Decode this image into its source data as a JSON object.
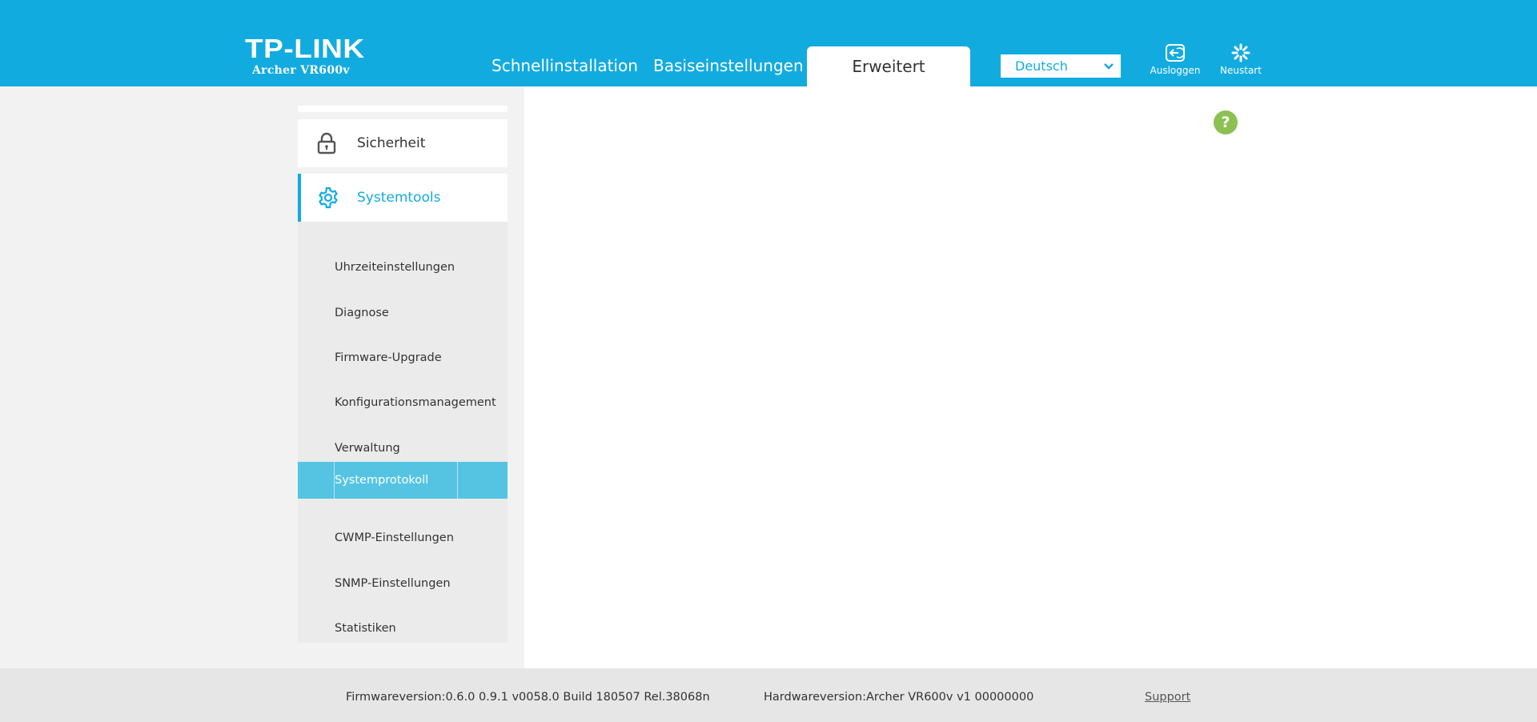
{
  "header": {
    "logo": "TP-LINK",
    "model": "Archer VR600v",
    "tabs": [
      {
        "label": "Schnellinstallation"
      },
      {
        "label": "Basiseinstellungen"
      },
      {
        "label": "Erweitert"
      }
    ],
    "language": "Deutsch",
    "logout_label": "Ausloggen",
    "reboot_label": "Neustart",
    "accent_color": "#12abe0"
  },
  "sidebar": {
    "sections": [
      {
        "label": "Sicherheit",
        "icon": "lock-icon"
      },
      {
        "label": "Systemtools",
        "icon": "gear-icon"
      }
    ],
    "items": [
      {
        "label": "Uhrzeiteinstellungen"
      },
      {
        "label": "Diagnose"
      },
      {
        "label": "Firmware-Upgrade"
      },
      {
        "label": "Konfigurationsmanagement"
      },
      {
        "label": "Verwaltung"
      },
      {
        "label": "Systemprotokoll"
      },
      {
        "label": "CWMP-Einstellungen"
      },
      {
        "label": "SNMP-Einstellungen"
      },
      {
        "label": "Statistiken"
      }
    ]
  },
  "help": {
    "label": "?"
  },
  "footer": {
    "firmware": "Firmwareversion:0.6.0 0.9.1 v0058.0 Build 180507 Rel.38068n",
    "hardware": "Hardwareversion:Archer VR600v v1 00000000",
    "support": "Support"
  }
}
